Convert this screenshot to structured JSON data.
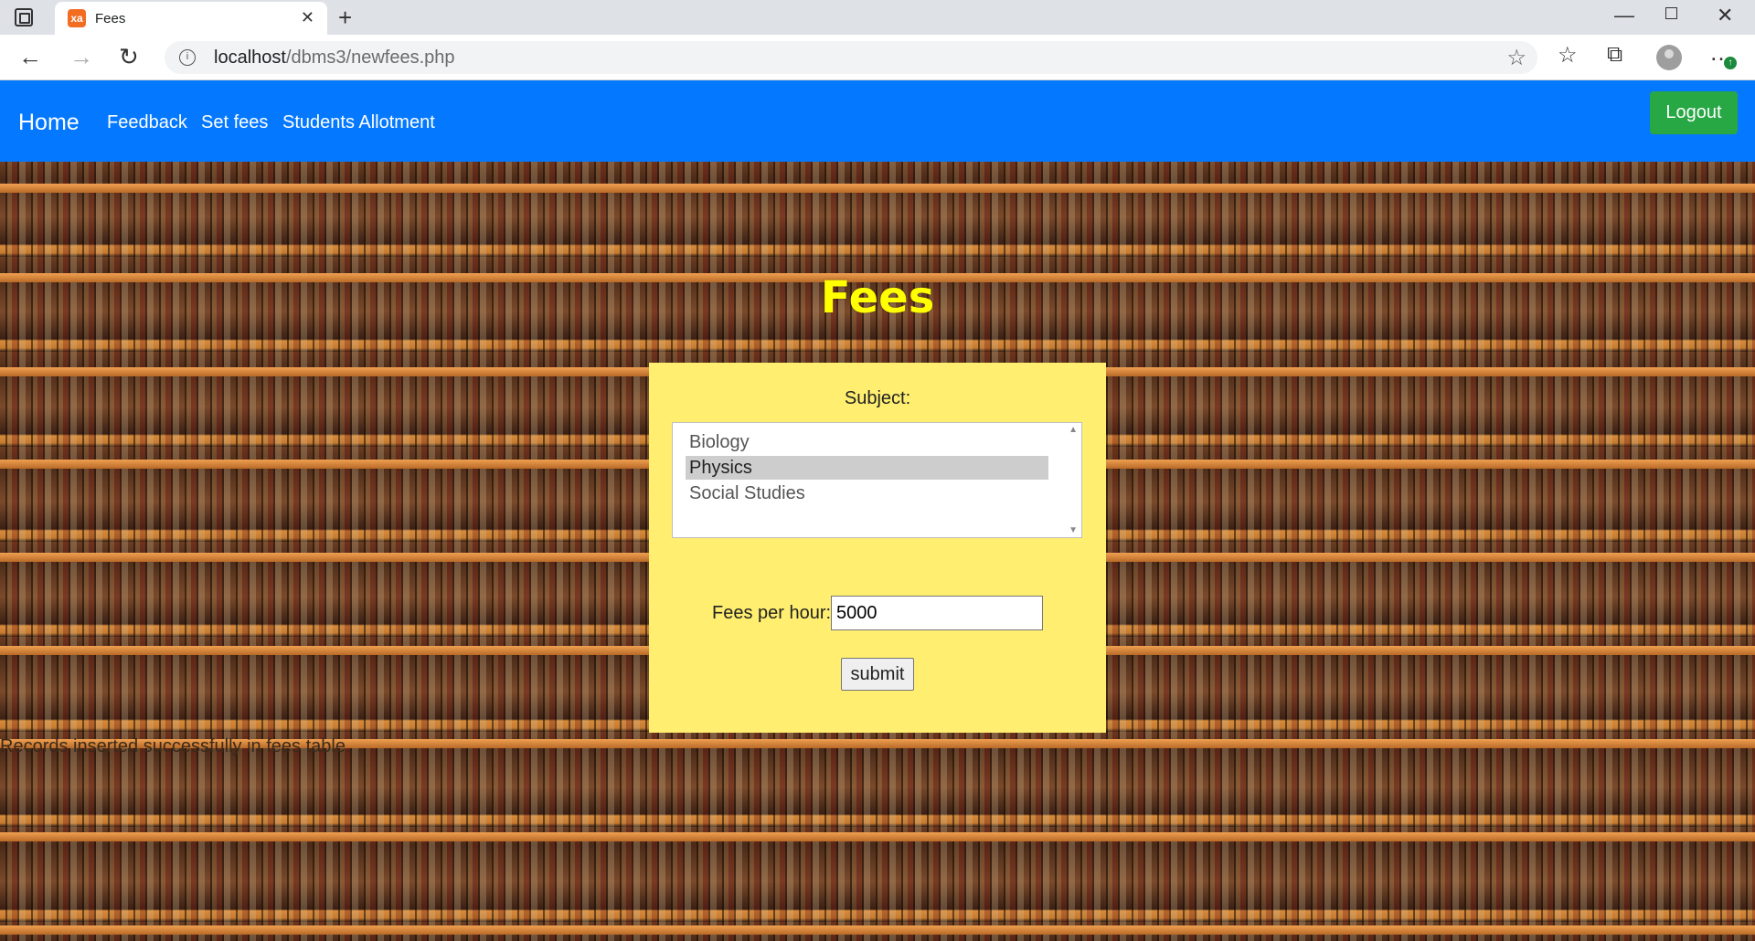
{
  "browser": {
    "tab_title": "Fees",
    "tab_favicon_text": "xa",
    "url_host": "localhost",
    "url_path": "/dbms3/newfees.php",
    "icons": [
      "tab-actions-icon",
      "close-icon",
      "new-tab-icon",
      "back-icon",
      "forward-icon",
      "reload-icon",
      "info-icon",
      "add-favorite-icon",
      "favorites-icon",
      "collections-icon",
      "profile-icon",
      "more-icon"
    ]
  },
  "nav": {
    "brand": "Home",
    "links": [
      "Feedback",
      "Set fees",
      "Students Allotment"
    ],
    "logout": "Logout",
    "colors": {
      "bar": "#0478ff",
      "logout": "#28a745"
    }
  },
  "page": {
    "title": "Fees",
    "title_color": "#ffff00",
    "panel_color": "#ffee70",
    "subject_label": "Subject:",
    "subjects": [
      "Biology",
      "Physics",
      "Social Studies"
    ],
    "selected_subject": "Physics",
    "fees_label": "Fees per hour:",
    "fees_value": "5000",
    "submit_label": "submit",
    "status_message": "Records inserted successfully in fees table."
  }
}
